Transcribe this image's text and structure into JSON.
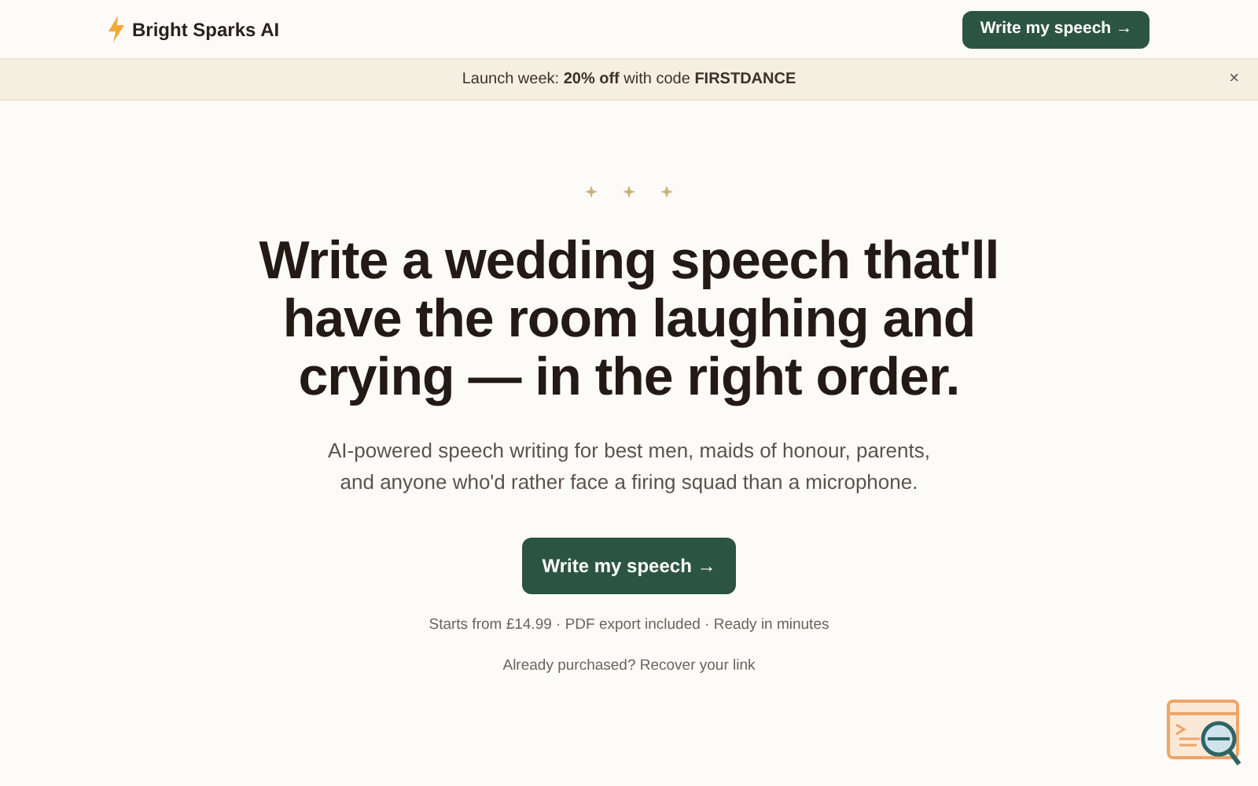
{
  "header": {
    "brand": "Bright Sparks AI",
    "cta": "Write my speech →"
  },
  "banner": {
    "text": "Launch week: **20% off** with code **FIRSTDANCE**",
    "close": "×"
  },
  "hero": {
    "title": "Write a wedding speech that'll have the room laughing and crying — in the right order.",
    "subtitle": "AI-powered speech writing for best men, maids of honour, parents, and anyone who'd rather face a firing squad than a microphone.",
    "cta": "Write my speech →",
    "features": "Starts from £14.99 · PDF export included · Ready in minutes",
    "recover": "Already purchased? Recover your link"
  }
}
